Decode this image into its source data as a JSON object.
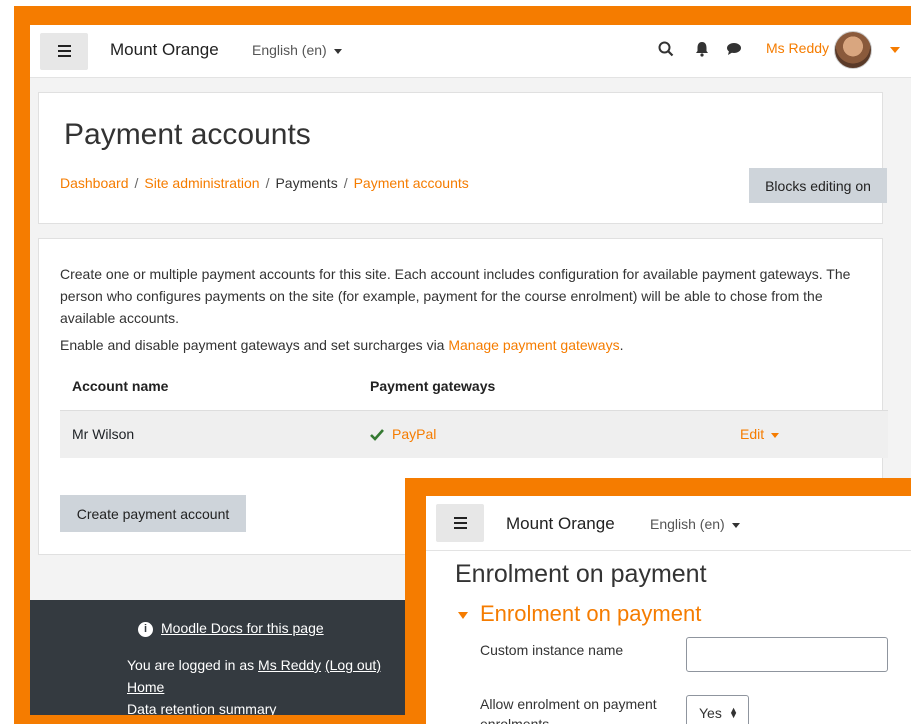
{
  "main": {
    "site_name": "Mount Orange",
    "language": "English (en)",
    "user_name": "Ms Reddy",
    "page_title": "Payment accounts",
    "breadcrumb": [
      "Dashboard",
      "Site administration",
      "Payments",
      "Payment accounts"
    ],
    "blocks_button": "Blocks editing on",
    "intro": "Create one or multiple payment accounts for this site. Each account includes configuration for available payment gateways. The person who configures payments on the site (for example, payment for the course enrolment) will be able to chose from the available accounts.",
    "intro2_prefix": "Enable and disable payment gateways and set surcharges via ",
    "intro2_link": "Manage payment gateways",
    "intro2_suffix": ".",
    "table": {
      "headers": [
        "Account name",
        "Payment gateways"
      ],
      "rows": [
        {
          "account": "Mr Wilson",
          "gateway": "PayPal",
          "action": "Edit"
        }
      ]
    },
    "create_button": "Create payment account",
    "footer": {
      "docs_link": "Moodle Docs for this page",
      "logged_prefix": "You are logged in as ",
      "logged_user": "Ms Reddy",
      "logout": "(Log out)",
      "home": "Home",
      "cut_text": "Data retention summary"
    }
  },
  "overlay": {
    "site_name": "Mount Orange",
    "language": "English (en)",
    "title": "Enrolment on payment",
    "section": "Enrolment on payment",
    "field1_label": "Custom instance name",
    "field2_label": "Allow enrolment on payment enrolments",
    "field2_value": "Yes"
  },
  "colors": {
    "accent": "#f57c00",
    "footer": "#343a40",
    "button": "#ced4da"
  }
}
